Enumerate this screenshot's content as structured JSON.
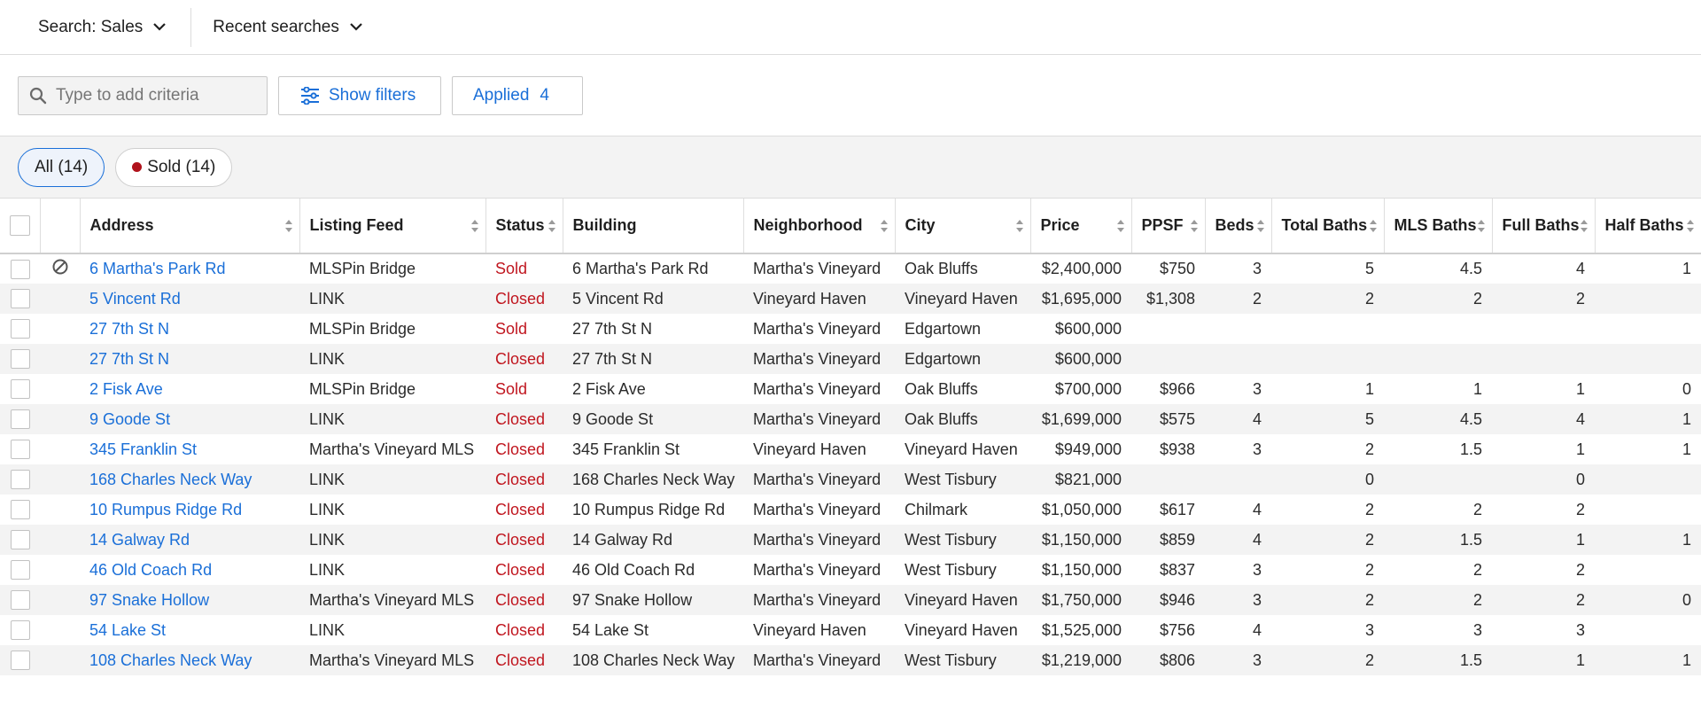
{
  "topbar": {
    "search_label": "Search: Sales",
    "recent_label": "Recent searches"
  },
  "criteria": {
    "search_placeholder": "Type to add criteria",
    "show_filters_label": "Show filters",
    "applied_label": "Applied",
    "applied_count": "4"
  },
  "tabs": {
    "all_label": "All (14)",
    "sold_label": "Sold (14)"
  },
  "colors": {
    "accent": "#1a6fd8",
    "status_red": "#c0161f",
    "sold_dot": "#b0121b"
  },
  "table": {
    "columns": [
      "Address",
      "Listing Feed",
      "Status",
      "Building",
      "Neighborhood",
      "City",
      "Price",
      "PPSF",
      "Beds",
      "Total Baths",
      "MLS Baths",
      "Full Baths",
      "Half Baths"
    ],
    "rows": [
      {
        "address": "6 Martha's Park Rd",
        "feed": "MLSPin Bridge",
        "status": "Sold",
        "building": "6 Martha's Park Rd",
        "neighborhood": "Martha's Vineyard",
        "city": "Oak Bluffs",
        "price": "$2,400,000",
        "ppsf": "$750",
        "beds": "3",
        "total_baths": "5",
        "mls_baths": "4.5",
        "full_baths": "4",
        "half_baths": "1",
        "flag": "hidden-icon"
      },
      {
        "address": "5 Vincent Rd",
        "feed": "LINK",
        "status": "Closed",
        "building": "5 Vincent Rd",
        "neighborhood": "Vineyard Haven",
        "city": "Vineyard Haven",
        "price": "$1,695,000",
        "ppsf": "$1,308",
        "beds": "2",
        "total_baths": "2",
        "mls_baths": "2",
        "full_baths": "2",
        "half_baths": ""
      },
      {
        "address": "27 7th St N",
        "feed": "MLSPin Bridge",
        "status": "Sold",
        "building": "27 7th St N",
        "neighborhood": "Martha's Vineyard",
        "city": "Edgartown",
        "price": "$600,000",
        "ppsf": "",
        "beds": "",
        "total_baths": "",
        "mls_baths": "",
        "full_baths": "",
        "half_baths": ""
      },
      {
        "address": "27 7th St N",
        "feed": "LINK",
        "status": "Closed",
        "building": "27 7th St N",
        "neighborhood": "Martha's Vineyard",
        "city": "Edgartown",
        "price": "$600,000",
        "ppsf": "",
        "beds": "",
        "total_baths": "",
        "mls_baths": "",
        "full_baths": "",
        "half_baths": ""
      },
      {
        "address": "2 Fisk Ave",
        "feed": "MLSPin Bridge",
        "status": "Sold",
        "building": "2 Fisk Ave",
        "neighborhood": "Martha's Vineyard",
        "city": "Oak Bluffs",
        "price": "$700,000",
        "ppsf": "$966",
        "beds": "3",
        "total_baths": "1",
        "mls_baths": "1",
        "full_baths": "1",
        "half_baths": "0"
      },
      {
        "address": "9 Goode St",
        "feed": "LINK",
        "status": "Closed",
        "building": "9 Goode St",
        "neighborhood": "Martha's Vineyard",
        "city": "Oak Bluffs",
        "price": "$1,699,000",
        "ppsf": "$575",
        "beds": "4",
        "total_baths": "5",
        "mls_baths": "4.5",
        "full_baths": "4",
        "half_baths": "1"
      },
      {
        "address": "345 Franklin St",
        "feed": "Martha's Vineyard MLS",
        "status": "Closed",
        "building": "345 Franklin St",
        "neighborhood": "Vineyard Haven",
        "city": "Vineyard Haven",
        "price": "$949,000",
        "ppsf": "$938",
        "beds": "3",
        "total_baths": "2",
        "mls_baths": "1.5",
        "full_baths": "1",
        "half_baths": "1"
      },
      {
        "address": "168 Charles Neck Way",
        "feed": "LINK",
        "status": "Closed",
        "building": "168 Charles Neck Way",
        "neighborhood": "Martha's Vineyard",
        "city": "West Tisbury",
        "price": "$821,000",
        "ppsf": "",
        "beds": "",
        "total_baths": "0",
        "mls_baths": "",
        "full_baths": "0",
        "half_baths": ""
      },
      {
        "address": "10 Rumpus Ridge Rd",
        "feed": "LINK",
        "status": "Closed",
        "building": "10 Rumpus Ridge Rd",
        "neighborhood": "Martha's Vineyard",
        "city": "Chilmark",
        "price": "$1,050,000",
        "ppsf": "$617",
        "beds": "4",
        "total_baths": "2",
        "mls_baths": "2",
        "full_baths": "2",
        "half_baths": ""
      },
      {
        "address": "14 Galway Rd",
        "feed": "LINK",
        "status": "Closed",
        "building": "14 Galway Rd",
        "neighborhood": "Martha's Vineyard",
        "city": "West Tisbury",
        "price": "$1,150,000",
        "ppsf": "$859",
        "beds": "4",
        "total_baths": "2",
        "mls_baths": "1.5",
        "full_baths": "1",
        "half_baths": "1"
      },
      {
        "address": "46 Old Coach Rd",
        "feed": "LINK",
        "status": "Closed",
        "building": "46 Old Coach Rd",
        "neighborhood": "Martha's Vineyard",
        "city": "West Tisbury",
        "price": "$1,150,000",
        "ppsf": "$837",
        "beds": "3",
        "total_baths": "2",
        "mls_baths": "2",
        "full_baths": "2",
        "half_baths": ""
      },
      {
        "address": "97 Snake Hollow",
        "feed": "Martha's Vineyard MLS",
        "status": "Closed",
        "building": "97 Snake Hollow",
        "neighborhood": "Martha's Vineyard",
        "city": "Vineyard Haven",
        "price": "$1,750,000",
        "ppsf": "$946",
        "beds": "3",
        "total_baths": "2",
        "mls_baths": "2",
        "full_baths": "2",
        "half_baths": "0"
      },
      {
        "address": "54 Lake St",
        "feed": "LINK",
        "status": "Closed",
        "building": "54 Lake St",
        "neighborhood": "Vineyard Haven",
        "city": "Vineyard Haven",
        "price": "$1,525,000",
        "ppsf": "$756",
        "beds": "4",
        "total_baths": "3",
        "mls_baths": "3",
        "full_baths": "3",
        "half_baths": ""
      },
      {
        "address": "108 Charles Neck Way",
        "feed": "Martha's Vineyard MLS",
        "status": "Closed",
        "building": "108 Charles Neck Way",
        "neighborhood": "Martha's Vineyard",
        "city": "West Tisbury",
        "price": "$1,219,000",
        "ppsf": "$806",
        "beds": "3",
        "total_baths": "2",
        "mls_baths": "1.5",
        "full_baths": "1",
        "half_baths": "1"
      }
    ]
  }
}
